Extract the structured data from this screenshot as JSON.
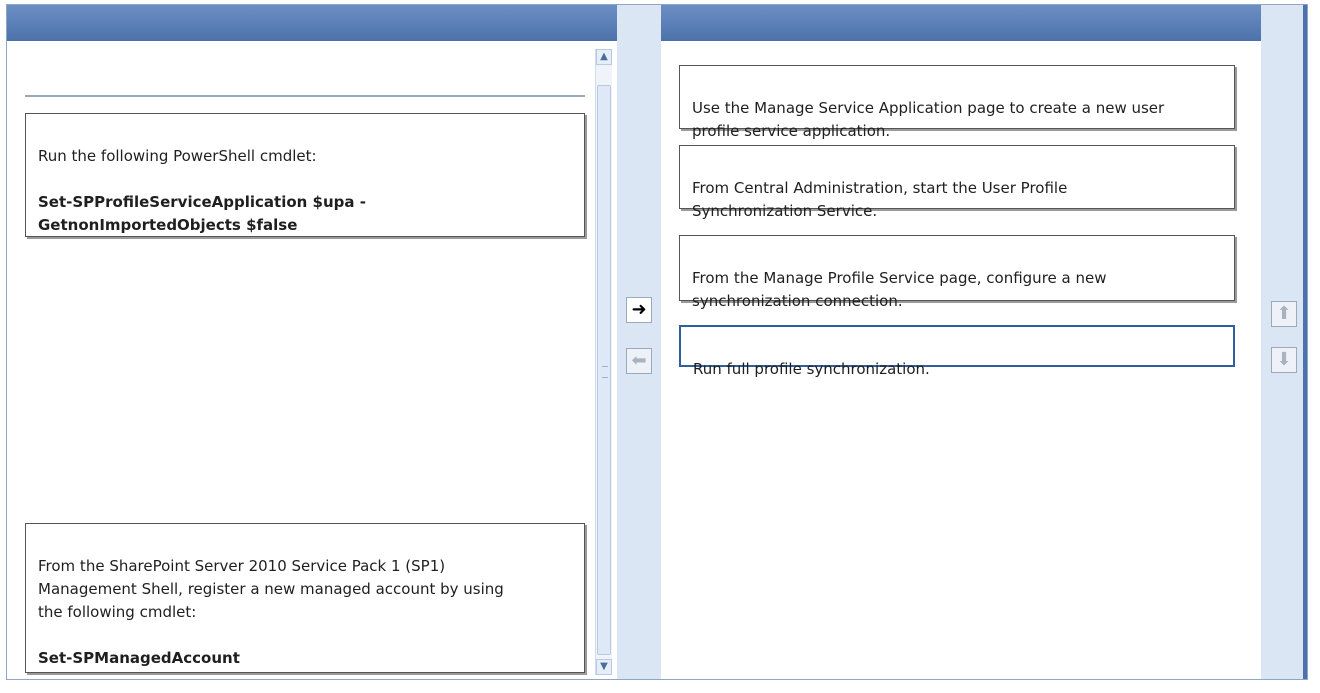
{
  "left_panel": {
    "items": [
      {
        "text": "",
        "cmd": ""
      },
      {
        "text": "Run the following PowerShell cmdlet:",
        "cmd": "Set-SPProfileServiceApplication $upa -\nGetnonImportedObjects $false"
      },
      {
        "text": "From the SharePoint Server 2010 Service Pack 1 (SP1)\nManagement Shell, register a new managed account by using\nthe following cmdlet:",
        "cmd": "Set-SPManagedAccount"
      }
    ]
  },
  "right_panel": {
    "items": [
      {
        "text": "Use the Manage Service Application page to create a new user\nprofile service application."
      },
      {
        "text": "From Central Administration, start the User Profile\nSynchronization Service."
      },
      {
        "text": "From the Manage Profile Service page, configure a new\nsynchronization connection."
      },
      {
        "text": "Run full profile synchronization."
      }
    ]
  },
  "controls": {
    "move_right_icon": "➜",
    "move_left_icon": "⬅",
    "move_up_icon": "⬆",
    "move_down_icon": "⬇",
    "scroll_up_icon": "▲",
    "scroll_down_icon": "▼"
  },
  "colors": {
    "header": "#5b80b8",
    "gutter": "#dbe6f4",
    "selected_border": "#2f5f9e"
  }
}
